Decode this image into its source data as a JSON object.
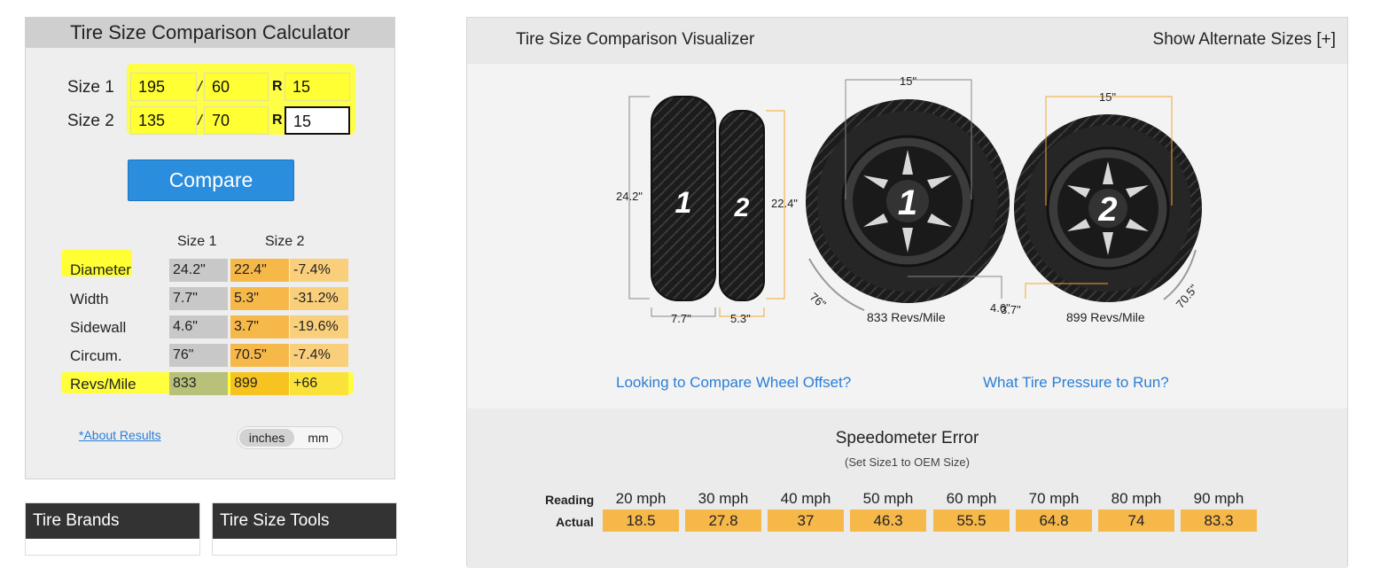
{
  "calculator": {
    "title": "Tire Size Comparison Calculator",
    "size1": {
      "label": "Size 1",
      "width": "195",
      "aspect": "60",
      "rim": "15"
    },
    "size2": {
      "label": "Size 2",
      "width": "135",
      "aspect": "70",
      "rim": "15"
    },
    "slash": "/",
    "r_sep": "R",
    "compare_label": "Compare",
    "col_size1": "Size 1",
    "col_size2": "Size 2",
    "rows": [
      {
        "label": "Diameter",
        "size1": "24.2\"",
        "size2": "22.4\"",
        "diff": "-7.4%"
      },
      {
        "label": "Width",
        "size1": "7.7\"",
        "size2": "5.3\"",
        "diff": "-31.2%"
      },
      {
        "label": "Sidewall",
        "size1": "4.6\"",
        "size2": "3.7\"",
        "diff": "-19.6%"
      },
      {
        "label": "Circum.",
        "size1": "76\"",
        "size2": "70.5\"",
        "diff": "-7.4%"
      },
      {
        "label": "Revs/Mile",
        "size1": "833",
        "size2": "899",
        "diff": "+66"
      }
    ],
    "about_link": "*About Results",
    "unit_inches": "inches",
    "unit_mm": "mm"
  },
  "cards": {
    "brands": "Tire Brands",
    "tools": "Tire Size Tools"
  },
  "visualizer": {
    "title": "Tire Size Comparison Visualizer",
    "alt_sizes": "Show Alternate Sizes [+]",
    "tire1": {
      "number": "1",
      "height": "24.2\"",
      "width": "7.7\"",
      "rim": "15\"",
      "sidewall": "4.6\"",
      "circ": "76\"",
      "revs": "833 Revs/Mile"
    },
    "tire2": {
      "number": "2",
      "height": "22.4\"",
      "width": "5.3\"",
      "rim": "15\"",
      "sidewall": "3.7\"",
      "circ": "70.5\"",
      "revs": "899 Revs/Mile"
    },
    "offset_link": "Looking to Compare Wheel Offset?",
    "pressure_link": "What Tire Pressure to Run?"
  },
  "speedometer": {
    "title": "Speedometer Error",
    "subtitle": "(Set Size1 to OEM Size)",
    "reading_label": "Reading",
    "actual_label": "Actual",
    "readings": [
      "20 mph",
      "30 mph",
      "40 mph",
      "50 mph",
      "60 mph",
      "70 mph",
      "80 mph",
      "90 mph"
    ],
    "actuals": [
      "18.5",
      "27.8",
      "37",
      "46.3",
      "55.5",
      "64.8",
      "74",
      "83.3"
    ]
  },
  "colors": {
    "accent_blue": "#2a8ddd",
    "highlight_yellow": "#ffff33",
    "orange": "#f7b84a",
    "link_blue": "#2a7ed6"
  }
}
